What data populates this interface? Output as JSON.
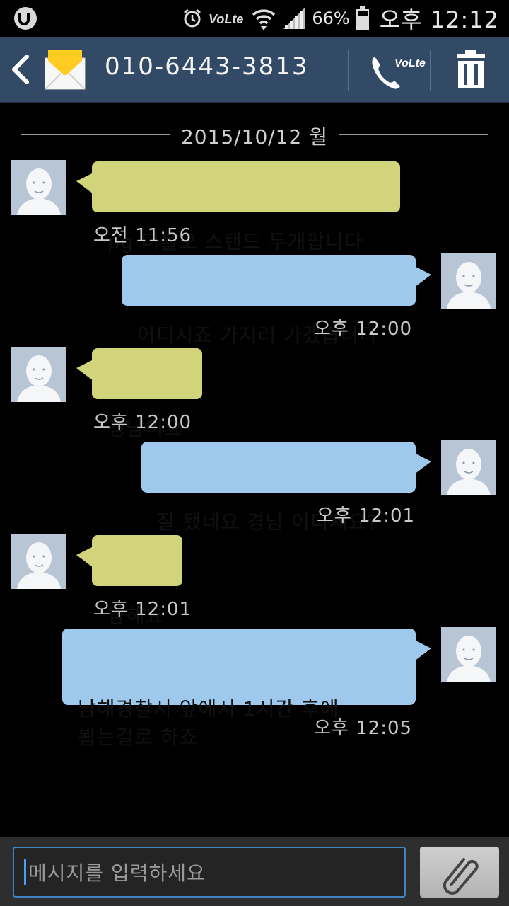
{
  "status_bar": {
    "battery": "66%",
    "time": "오후 12:12",
    "icons": [
      "uplus-icon",
      "alarm-icon",
      "volte-icon",
      "wifi-icon",
      "signal-icon",
      "battery-icon"
    ]
  },
  "header": {
    "phone_number": "010-6443-3813",
    "back_icon": "back-arrow-icon",
    "envelope_icon": "envelope-icon",
    "call_icon": "volte-call-icon",
    "delete_icon": "trash-icon"
  },
  "conversation": {
    "date": "2015/10/12 월",
    "messages": [
      {
        "direction": "in",
        "text": "pg 더블오 스탠드 두개팝니다",
        "time": "오전 11:56"
      },
      {
        "direction": "out",
        "text": "어디시죠 가지러 가겠습니다",
        "time": "오후 12:00"
      },
      {
        "direction": "in",
        "text": "경남이요",
        "time": "오후 12:00"
      },
      {
        "direction": "out",
        "text": "잘 됐네요 경남 어디세요?",
        "time": "오후 12:01"
      },
      {
        "direction": "in",
        "text": "남해요",
        "time": "오후 12:01"
      },
      {
        "direction": "out",
        "text": "남해경찰서 앞에서 1시간 후에\n뵙는걸로 하죠",
        "time": "오후 12:05"
      }
    ]
  },
  "composer": {
    "placeholder": "메시지를 입력하세요",
    "attach_icon": "paperclip-icon"
  },
  "colors": {
    "header_bg": "#334a66",
    "incoming_bubble": "#d2d47c",
    "outgoing_bubble": "#9ec8ec",
    "input_border": "#3f82c6"
  }
}
